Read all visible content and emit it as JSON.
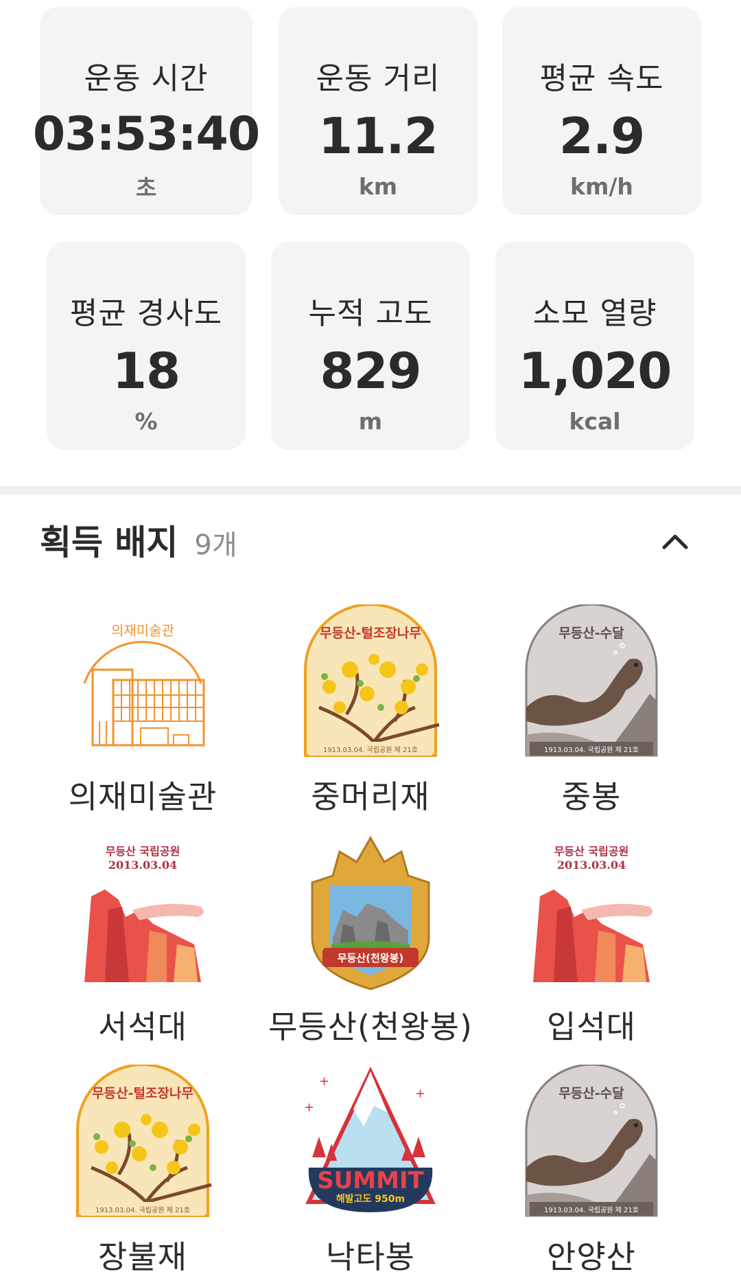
{
  "stats": [
    {
      "label": "운동 시간",
      "value": "03:53:40",
      "unit": "초"
    },
    {
      "label": "운동 거리",
      "value": "11.2",
      "unit": "km"
    },
    {
      "label": "평균 속도",
      "value": "2.9",
      "unit": "km/h"
    },
    {
      "label": "평균 경사도",
      "value": "18",
      "unit": "%"
    },
    {
      "label": "누적 고도",
      "value": "829",
      "unit": "m"
    },
    {
      "label": "소모 열량",
      "value": "1,020",
      "unit": "kcal"
    }
  ],
  "badges_section": {
    "title": "획득 배지",
    "count": "9개",
    "badges": [
      {
        "name": "의재미술관",
        "art_text": "의재미술관",
        "icon": "museum-badge"
      },
      {
        "name": "중머리재",
        "art_text": "무등산-털조장나무",
        "footer": "1913.03.04. 국립공원 제 21호",
        "icon": "forsythia-badge"
      },
      {
        "name": "중봉",
        "art_text": "무등산-수달",
        "footer": "1913.03.04. 국립공원 제 21호",
        "icon": "otter-badge"
      },
      {
        "name": "서석대",
        "art_text": "무등산 국립공원",
        "art_date": "2013.03.04",
        "icon": "rock-pillar-badge"
      },
      {
        "name": "무등산(천왕봉)",
        "art_text": "무등산(천왕봉)",
        "icon": "mountain-shield-badge"
      },
      {
        "name": "입석대",
        "art_text": "무등산 국립공원",
        "art_date": "2013.03.04",
        "icon": "rock-pillar-badge"
      },
      {
        "name": "장불재",
        "art_text": "무등산-털조장나무",
        "footer": "1913.03.04. 국립공원 제 21호",
        "icon": "forsythia-badge"
      },
      {
        "name": "낙타봉",
        "art_text": "SUMMIT",
        "art_sub": "해발고도 950m",
        "icon": "summit-badge"
      },
      {
        "name": "안양산",
        "art_text": "무등산-수달",
        "footer": "1913.03.04. 국립공원 제 21호",
        "icon": "otter-badge"
      }
    ]
  },
  "colors": {
    "card_bg": "#f4f4f4",
    "museum_orange": "#f5922a",
    "forsythia_bg": "#f9e6b8",
    "otter_bg": "#d8d3d1",
    "rock_red": "#e8524a",
    "summit_navy": "#233a5e",
    "summit_red": "#d8323a"
  }
}
